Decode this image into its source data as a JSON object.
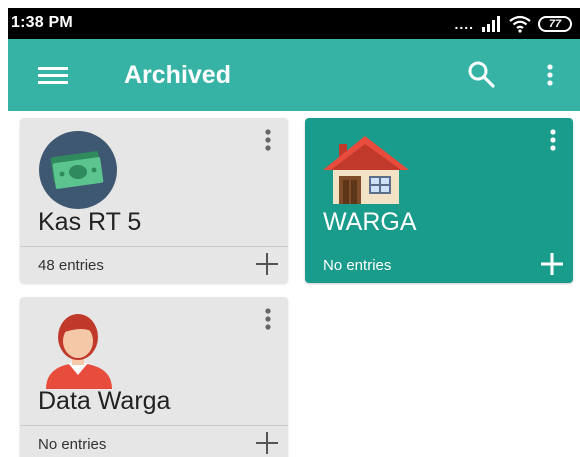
{
  "status_bar": {
    "time": "1:38 PM",
    "signal_dots": "....",
    "battery": "77"
  },
  "app_bar": {
    "title": "Archived",
    "menu_icon": "hamburger-menu-icon",
    "search_icon": "search-icon",
    "overflow_icon": "more-vert-icon"
  },
  "cards": [
    {
      "title": "Kas RT 5",
      "entries": "48 entries",
      "icon": "money-icon",
      "color": "#e6e6e6"
    },
    {
      "title": "WARGA",
      "entries": "No entries",
      "icon": "house-icon",
      "color": "#1a9c8d"
    },
    {
      "title": "Data Warga",
      "entries": "No entries",
      "icon": "person-icon",
      "color": "#e6e6e6"
    }
  ],
  "colors": {
    "app_bar": "#36b3a5",
    "teal_card": "#1a9c8d",
    "grey_card": "#e6e6e6"
  }
}
